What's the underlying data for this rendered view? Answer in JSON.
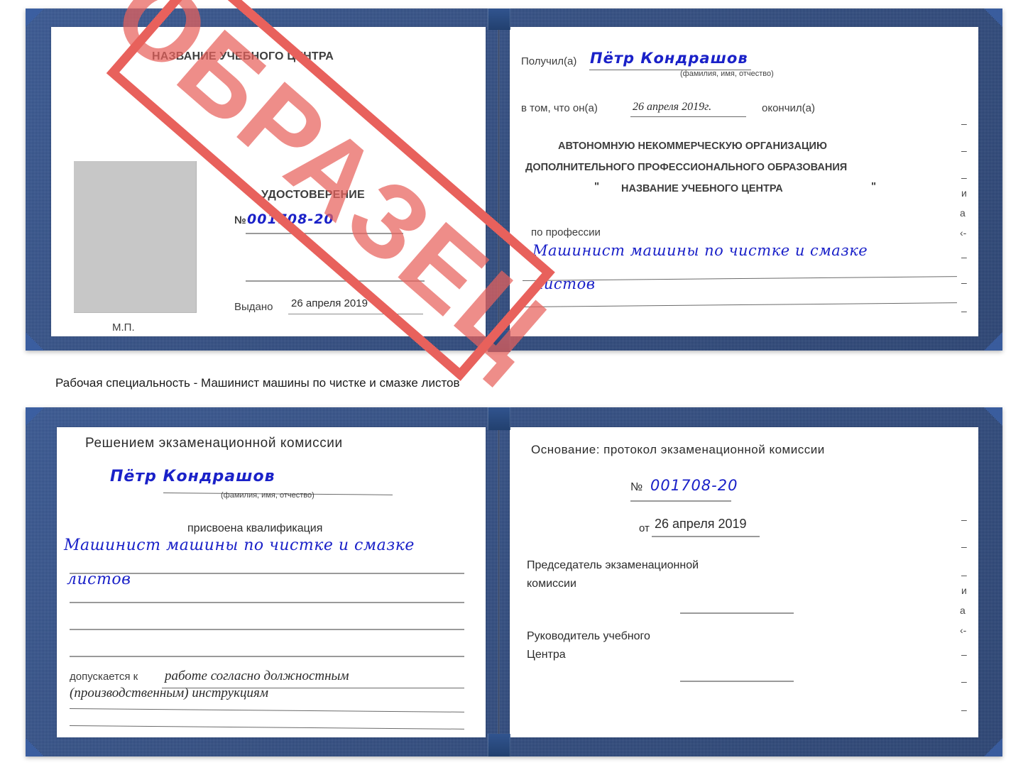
{
  "caption": "Рабочая специальность - Машинист машины по чистке и смазке листов",
  "colors": {
    "cover": "#27457e",
    "stamp": "#e8615c",
    "handwriting": "#1a21c8",
    "photo_placeholder": "#c7c7c7"
  },
  "stamp": {
    "text": "ОБРАЗЕЦ"
  },
  "certificate_top": {
    "left_page": {
      "org_title": "НАЗВАНИЕ УЧЕБНОГО ЦЕНТРА",
      "doc_type": "УДОСТОВЕРЕНИЕ",
      "number_prefix": "№",
      "number_value": "001708-20",
      "issued_label": "Выдано",
      "issued_value": "26 апреля 2019",
      "seal_label": "М.П."
    },
    "right_page": {
      "received_label": "Получил(а)",
      "received_value": "Пётр Кондрашов",
      "fio_hint": "(фамилия, имя, отчество)",
      "in_that_label": "в том, что он(а)",
      "completion_date": "26 апреля 2019г.",
      "finished_label": "окончил(а)",
      "org_line1": "АВТОНОМНУЮ НЕКОММЕРЧЕСКУЮ ОРГАНИЗАЦИЮ",
      "org_line2": "ДОПОЛНИТЕЛЬНОГО ПРОФЕССИОНАЛЬНОГО ОБРАЗОВАНИЯ",
      "org_quote_open": "\"",
      "org_line3": "НАЗВАНИЕ УЧЕБНОГО ЦЕНТРА",
      "org_quote_close": "\"",
      "profession_label": "по профессии",
      "profession_value_line1": "Машинист машины по чистке и смазке",
      "profession_value_line2": "листов",
      "edge_fragments": [
        "–",
        "–",
        "–",
        "и",
        "а",
        "‹-",
        "–",
        "–",
        "–"
      ]
    }
  },
  "certificate_bottom": {
    "left_page": {
      "heading": "Решением экзаменационной комиссии",
      "name_value": "Пётр Кондрашов",
      "fio_hint": "(фамилия, имя, отчество)",
      "qualification_label": "присвоена квалификация",
      "qualification_line1": "Машинист машины по чистке и смазке",
      "qualification_line2": "листов",
      "admitted_label": "допускается к",
      "admitted_value_line1": "работе согласно должностным",
      "admitted_value_line2": "(производственным) инструкциям"
    },
    "right_page": {
      "basis_label": "Основание: протокол экзаменационной комиссии",
      "number_prefix": "№",
      "number_value": "001708-20",
      "date_prefix": "от",
      "date_value": "26 апреля 2019",
      "chairman_line1": "Председатель экзаменационной",
      "chairman_line2": "комиссии",
      "head_line1": "Руководитель учебного",
      "head_line2": "Центра",
      "edge_fragments": [
        "–",
        "–",
        "–",
        "и",
        "а",
        "‹-",
        "–",
        "–",
        "–"
      ]
    }
  }
}
